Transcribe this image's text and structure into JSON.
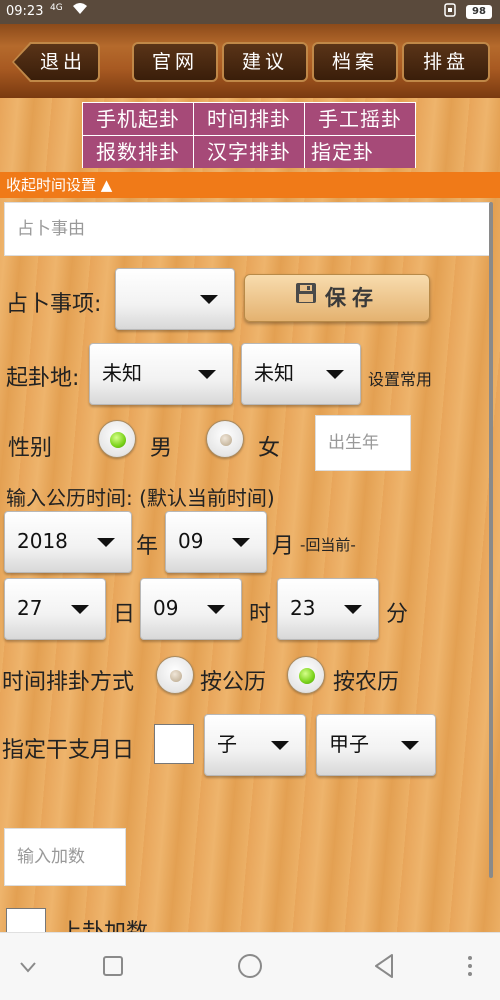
{
  "status_bar": {
    "time": "09:23",
    "signal": "4G",
    "battery": "98"
  },
  "toolbar": {
    "back_label": "退出",
    "buttons": [
      "官网",
      "建议",
      "档案",
      "排盘"
    ]
  },
  "modes": [
    "手机起卦",
    "时间排卦",
    "手工摇卦",
    "报数排卦",
    "汉字排卦",
    "指定卦"
  ],
  "collapse_label": "收起时间设置 ▲",
  "reason_placeholder": "占卜事由",
  "divination_item": {
    "label": "占卜事项:",
    "value": ""
  },
  "save_label": "保存",
  "location": {
    "label": "起卦地:",
    "province": "未知",
    "city": "未知",
    "set_common": "设置常用"
  },
  "gender": {
    "label": "性别",
    "male": "男",
    "female": "女",
    "selected": "male",
    "birth_year_placeholder": "出生年"
  },
  "date_time": {
    "heading": "输入公历时间: (默认当前时间)",
    "year": "2018",
    "year_unit": "年",
    "month": "09",
    "month_unit": "月",
    "return_now": "-回当前-",
    "day": "27",
    "day_unit": "日",
    "hour": "09",
    "hour_unit": "时",
    "minute": "23",
    "minute_unit": "分"
  },
  "method": {
    "label": "时间排卦方式",
    "solar": "按公历",
    "lunar": "按农历",
    "selected": "lunar"
  },
  "ganzhi": {
    "label": "指定干支月日",
    "checked": false,
    "branch": "子",
    "stem_branch": "甲子"
  },
  "add_number_placeholder": "输入加数",
  "upper_add_label": "上卦加数"
}
